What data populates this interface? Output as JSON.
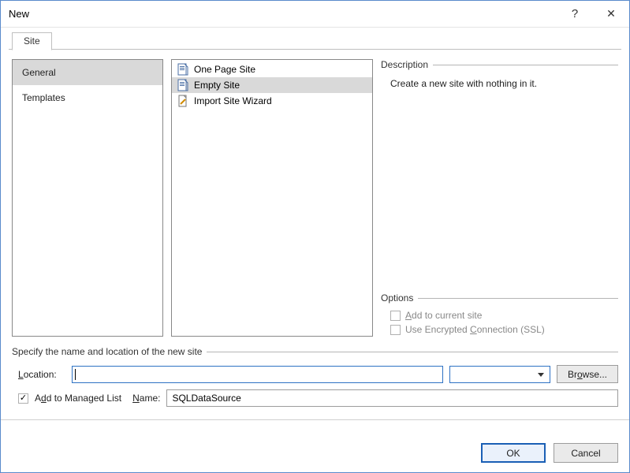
{
  "window": {
    "title": "New"
  },
  "tabs": {
    "site": "Site"
  },
  "categories": {
    "items": [
      {
        "label": "General",
        "selected": true
      },
      {
        "label": "Templates",
        "selected": false
      }
    ]
  },
  "templates": {
    "items": [
      {
        "label": "One Page Site",
        "selected": false,
        "icon": "page-icon"
      },
      {
        "label": "Empty Site",
        "selected": true,
        "icon": "page-icon"
      },
      {
        "label": "Import Site Wizard",
        "selected": false,
        "icon": "wizard-icon"
      }
    ]
  },
  "description": {
    "heading": "Description",
    "text": "Create a new site with nothing in it."
  },
  "options": {
    "heading": "Options",
    "add_current": {
      "label_pre": "",
      "u": "A",
      "label_post": "dd to current site",
      "checked": false
    },
    "ssl": {
      "label_pre": "Use Encrypted ",
      "u": "C",
      "label_post": "onnection (SSL)",
      "checked": false
    }
  },
  "specify": {
    "heading": "Specify the name and location of the new site",
    "location": {
      "label_pre": "",
      "u": "L",
      "label_post": "ocation:",
      "value": ""
    },
    "browse": {
      "label_pre": "Br",
      "u": "o",
      "label_post": "wse..."
    },
    "managed": {
      "label_pre": "A",
      "u": "d",
      "label_post": "d to Managed List",
      "checked": true
    },
    "name": {
      "label_pre": "",
      "u": "N",
      "label_post": "ame:",
      "value": "SQLDataSource"
    }
  },
  "footer": {
    "ok": "OK",
    "cancel": "Cancel"
  }
}
